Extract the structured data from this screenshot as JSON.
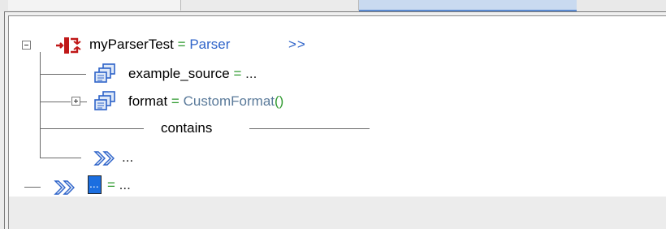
{
  "tree": {
    "root": {
      "name": "myParserTest",
      "eq": "=",
      "type": "Parser",
      "arrows": ">>"
    },
    "child_source": {
      "name": "example_source",
      "eq": "=",
      "value": "..."
    },
    "child_format": {
      "name": "format",
      "eq": "=",
      "call": "CustomFormat",
      "parens": "()"
    },
    "contains_label": "contains",
    "placeholder_dots": "...",
    "bottom": {
      "selected": "...",
      "eq": "=",
      "value": "..."
    }
  },
  "icons": {
    "root": "parser-icon",
    "node": "object-copy-icon",
    "add": "double-chevron-icon"
  },
  "colors": {
    "identifier": "#000000",
    "operator": "#2f9a2f",
    "type": "#2e63c9",
    "call": "#5a7a9a",
    "selection": "#1b6ee0"
  }
}
